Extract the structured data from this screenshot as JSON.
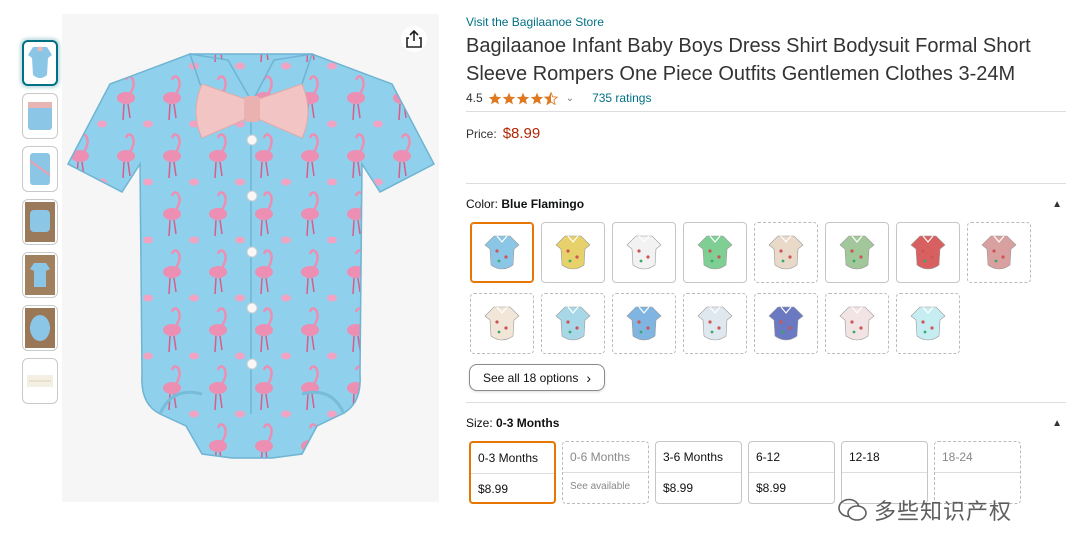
{
  "store": {
    "link_text": "Visit the Bagilaanoe Store"
  },
  "product": {
    "title": "Bagilaanoe Infant Baby Boys Dress Shirt Bodysuit Formal Short Sleeve Rompers One Piece Outfits Gentlemen Clothes 3-24M",
    "rating": "4.5",
    "rating_value": 4.5,
    "ratings_count": "735 ratings"
  },
  "price": {
    "label": "Price:",
    "value": "$8.99"
  },
  "color": {
    "label": "Color:",
    "selected": "Blue Flamingo",
    "swatch_colors": [
      "#8cc6e6",
      "#e6d16a",
      "#f2f2f2",
      "#7fcf95",
      "#e8d9c9",
      "#a2c79a",
      "#d96060",
      "#d9a0a0",
      "#f2e6d9",
      "#a8d8e8",
      "#7fb5e0",
      "#dfe8ef",
      "#6a79c2",
      "#f2e4e4",
      "#c6eef2"
    ],
    "see_all": "See all 18 options"
  },
  "size": {
    "label": "Size:",
    "selected": "0-3 Months",
    "options": [
      {
        "name": "0-3 Months",
        "price": "$8.99",
        "state": "selected"
      },
      {
        "name": "0-6 Months",
        "price": "See available",
        "state": "unavailable"
      },
      {
        "name": "3-6 Months",
        "price": "$8.99",
        "state": "available"
      },
      {
        "name": "6-12",
        "price": "$8.99",
        "state": "available"
      },
      {
        "name": "12-18",
        "price": "",
        "state": "available"
      },
      {
        "name": "18-24",
        "price": "",
        "state": "unavailable"
      }
    ]
  },
  "watermark": {
    "text": "多些知识产权"
  },
  "colors": {
    "link": "#007185",
    "price": "#b12704",
    "selected": "#e77600",
    "star": "#de7921"
  }
}
